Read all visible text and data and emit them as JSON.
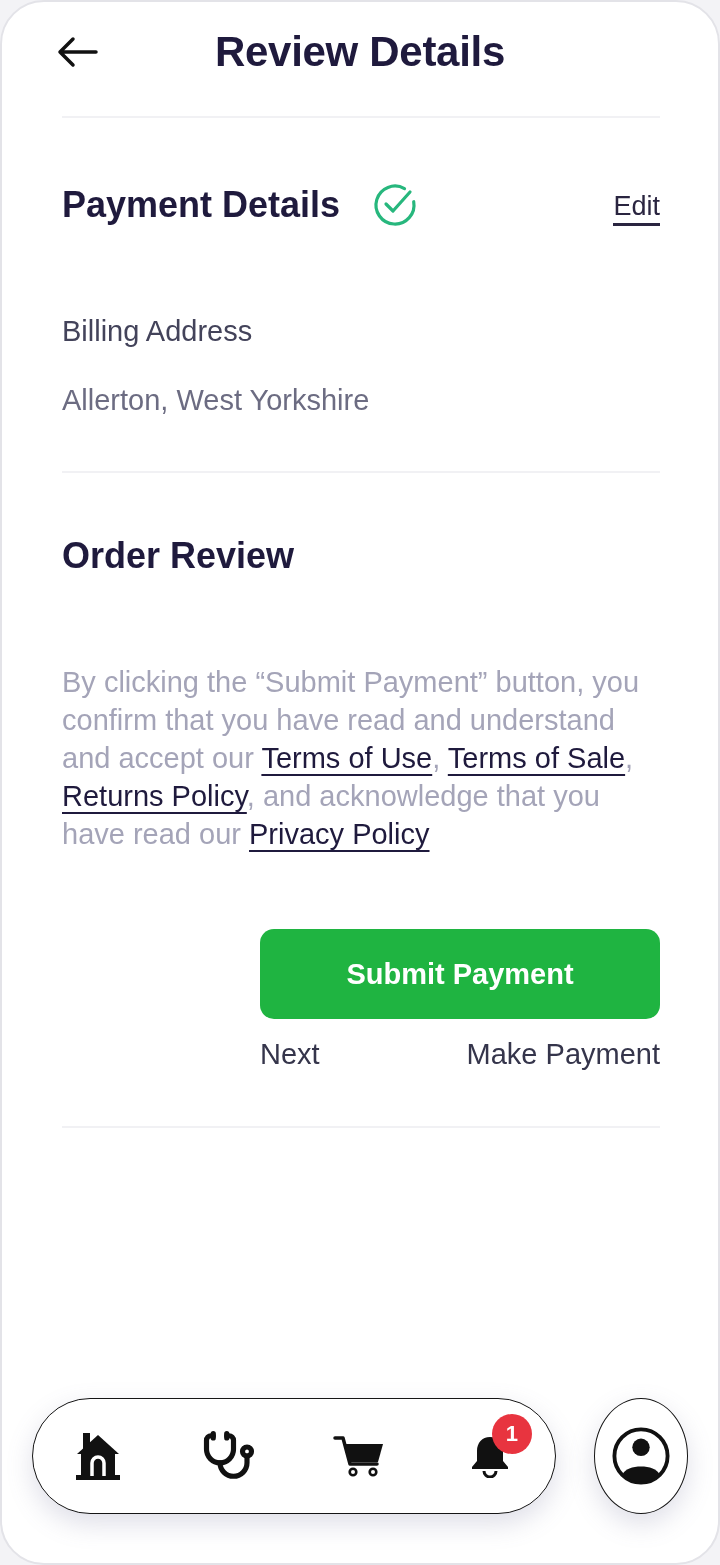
{
  "header": {
    "title": "Review Details"
  },
  "payment_details": {
    "title": "Payment Details",
    "edit_link": "Edit",
    "billing_label": "Billing Address",
    "billing_address": "Allerton, West Yorkshire"
  },
  "order_review": {
    "title": "Order Review",
    "terms": [
      {
        "kind": "text",
        "text": "By clicking the “Submit Payment” button, you confirm that you have read and understand and accept our "
      },
      {
        "kind": "link",
        "text": "Terms of Use"
      },
      {
        "kind": "text",
        "text": ", "
      },
      {
        "kind": "link",
        "text": "Terms of Sale"
      },
      {
        "kind": "text",
        "text": ", "
      },
      {
        "kind": "link",
        "text": "Returns Policy"
      },
      {
        "kind": "text",
        "text": ", and acknowledge that you have read our "
      },
      {
        "kind": "link",
        "text": "Privacy Policy"
      }
    ]
  },
  "actions": {
    "submit_button": "Submit Payment",
    "captions": [
      "Next",
      "Make Payment"
    ]
  },
  "bottom_nav": {
    "items": [
      {
        "kind": "home"
      },
      {
        "kind": "stethoscope"
      },
      {
        "kind": "cart"
      },
      {
        "kind": "bell",
        "badge": "1"
      }
    ]
  }
}
